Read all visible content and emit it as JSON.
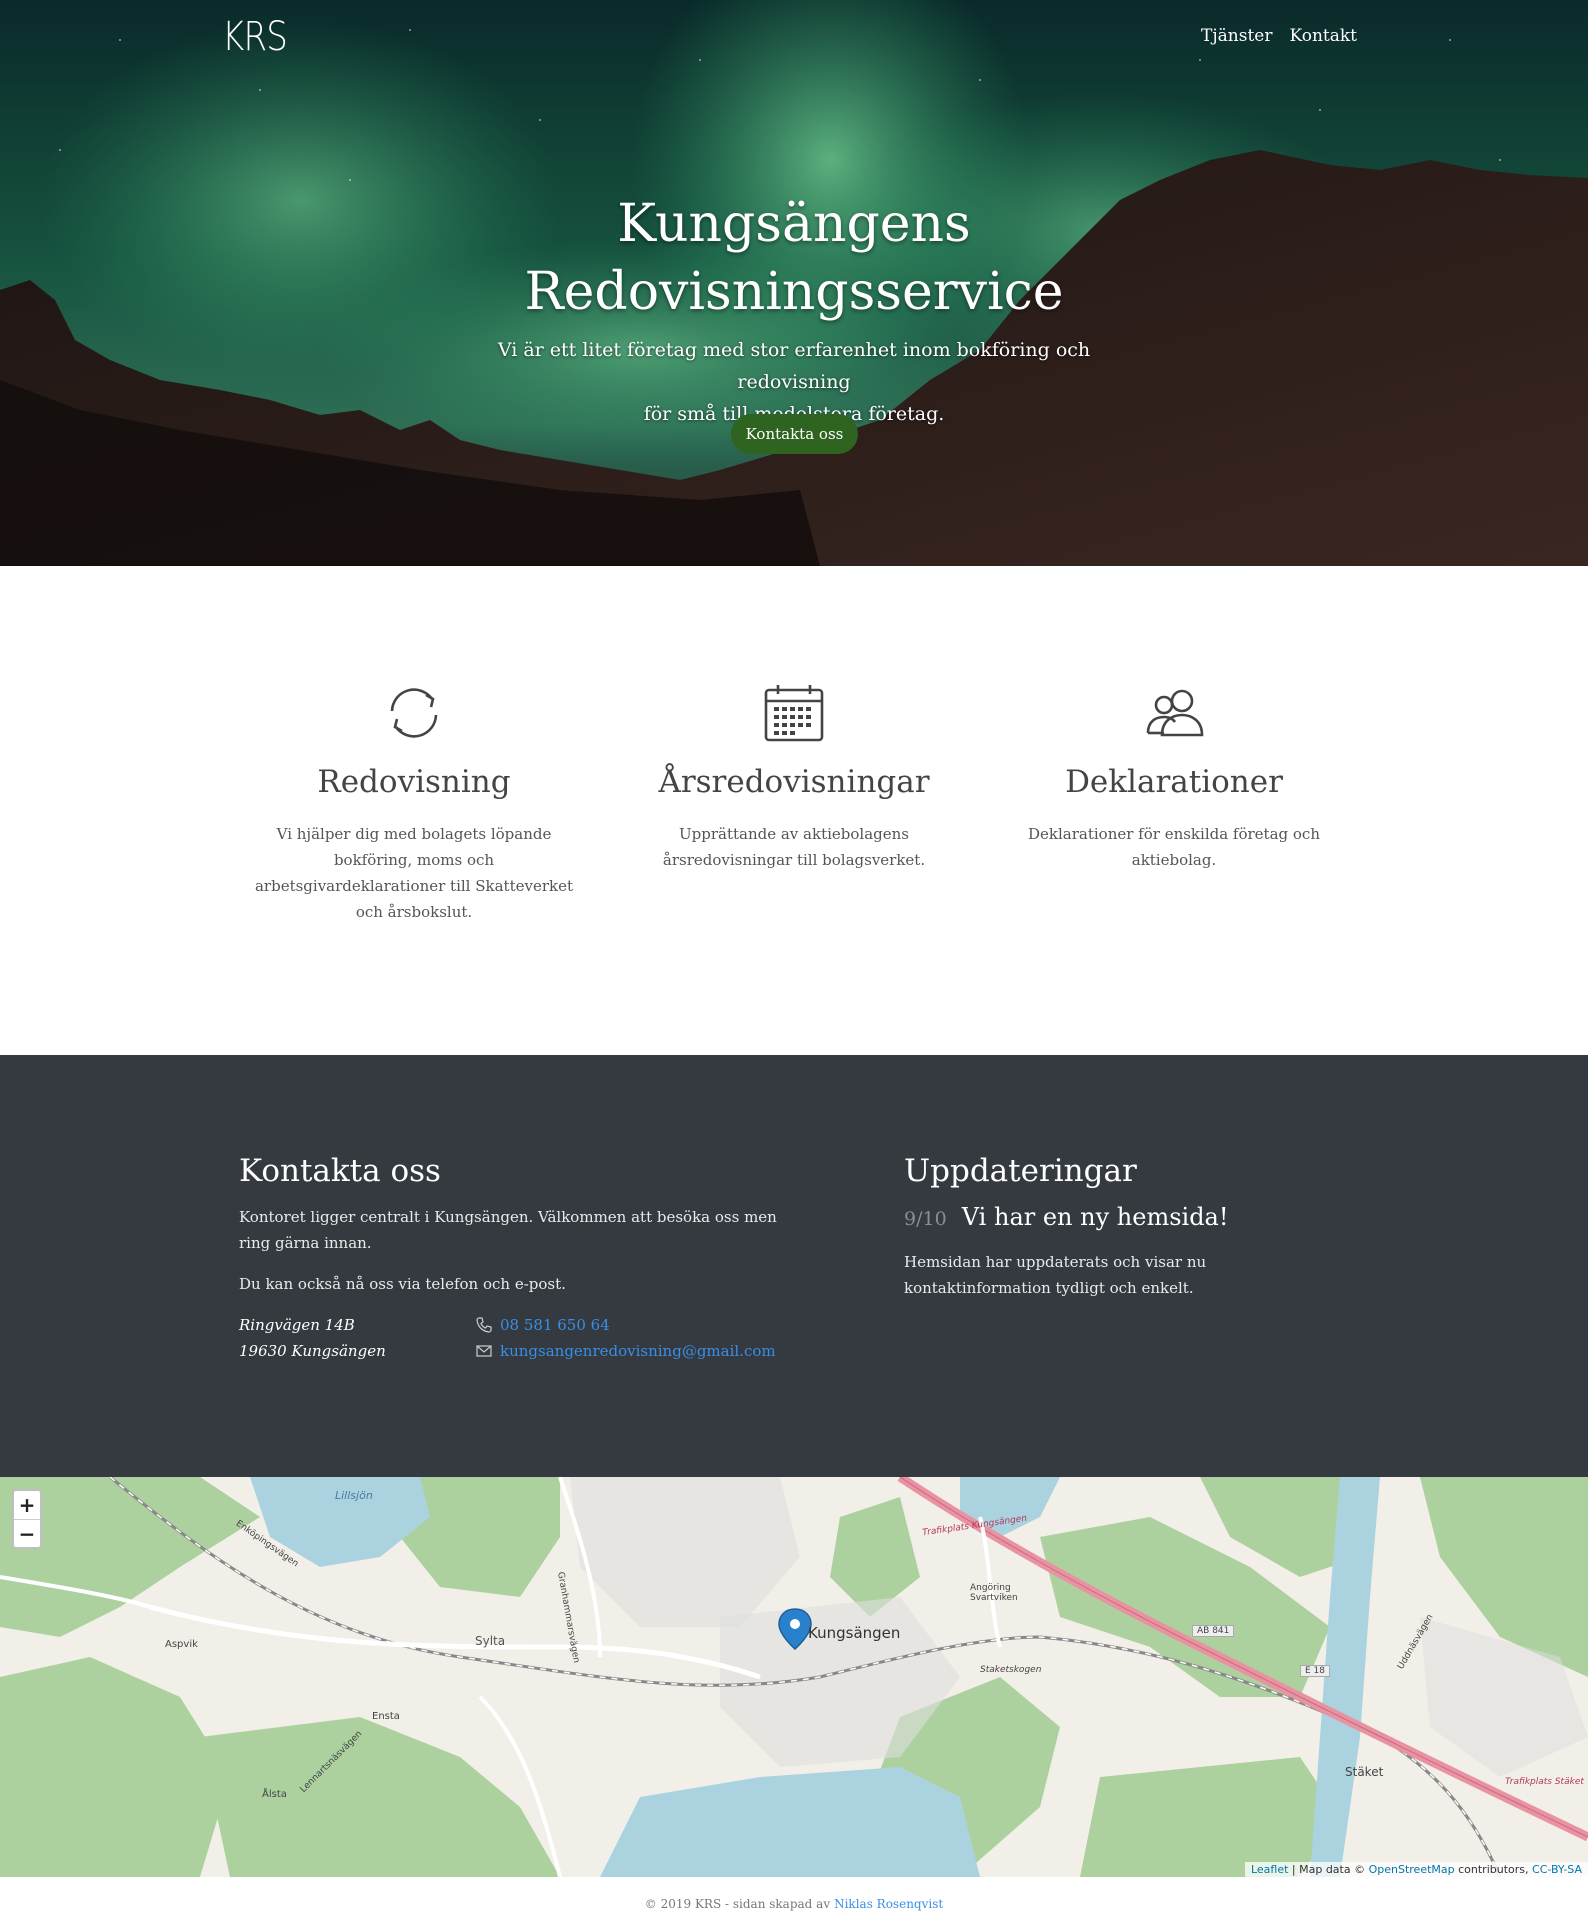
{
  "header": {
    "logo": "KRS",
    "nav": [
      {
        "label": "Tjänster"
      },
      {
        "label": "Kontakt"
      }
    ]
  },
  "hero": {
    "title_line1": "Kungsängens",
    "title_line2": "Redovisningsservice",
    "subtitle_line1": "Vi är ett litet företag med stor erfarenhet inom bokföring och redovisning",
    "subtitle_line2": "för små till medelstora företag.",
    "cta_label": "Kontakta oss"
  },
  "services": [
    {
      "icon": "refresh-icon",
      "title": "Redovisning",
      "text": "Vi hjälper dig med bolagets löpande bokföring, moms och arbetsgivardeklarationer till Skatteverket och årsbokslut."
    },
    {
      "icon": "calendar-icon",
      "title": "Årsredovisningar",
      "text": "Upprättande av aktiebolagens årsredovisningar till bolagsverket."
    },
    {
      "icon": "users-icon",
      "title": "Deklarationer",
      "text": "Deklarationer för enskilda företag och aktiebolag."
    }
  ],
  "contact": {
    "heading": "Kontakta oss",
    "intro": "Kontoret ligger centralt i Kungsängen. Välkommen att besöka oss men ring gärna innan.",
    "reach": "Du kan också nå oss via telefon och e-post.",
    "address_line1": "Ringvägen 14B",
    "address_line2": "19630 Kungsängen",
    "phone": "08 581 650 64",
    "email": "kungsangenredovisning@gmail.com"
  },
  "updates": {
    "heading": "Uppdateringar",
    "items": [
      {
        "date": "9/10",
        "title": "Vi har en ny hemsida!",
        "text": "Hemsidan har uppdaterats och visar nu kontaktinformation tydligt och enkelt."
      }
    ]
  },
  "map": {
    "zoom_in": "+",
    "zoom_out": "−",
    "labels": [
      "Lillsjön",
      "Enköpingsvägen",
      "Aspvik",
      "Sylta",
      "Ensta",
      "Ålsta",
      "Granhammarsvägen",
      "Kungsängen",
      "Trafikplats Kungsängen",
      "Angöring Svartviken",
      "Staketskogen",
      "AB 841",
      "E 18",
      "Stäket",
      "Trafikplats Stäket",
      "Lennartsnäsvägen",
      "Uddnäsvägen"
    ],
    "attribution": {
      "leaflet": "Leaflet",
      "sep1": " | Map data © ",
      "osm": "OpenStreetMap",
      "contrib": " contributors, ",
      "license": "CC-BY-SA"
    },
    "colors": {
      "forest": "#add19e",
      "water": "#aad3df",
      "motorway": "#e892a2",
      "land": "#f2efe9"
    }
  },
  "footer": {
    "text": "© 2019 KRS - sidan skapad av",
    "author": "Niklas Rosenqvist"
  },
  "colors": {
    "accent_button": "#2f6320",
    "dark_section": "#343a40",
    "link": "#3a8ee6"
  }
}
